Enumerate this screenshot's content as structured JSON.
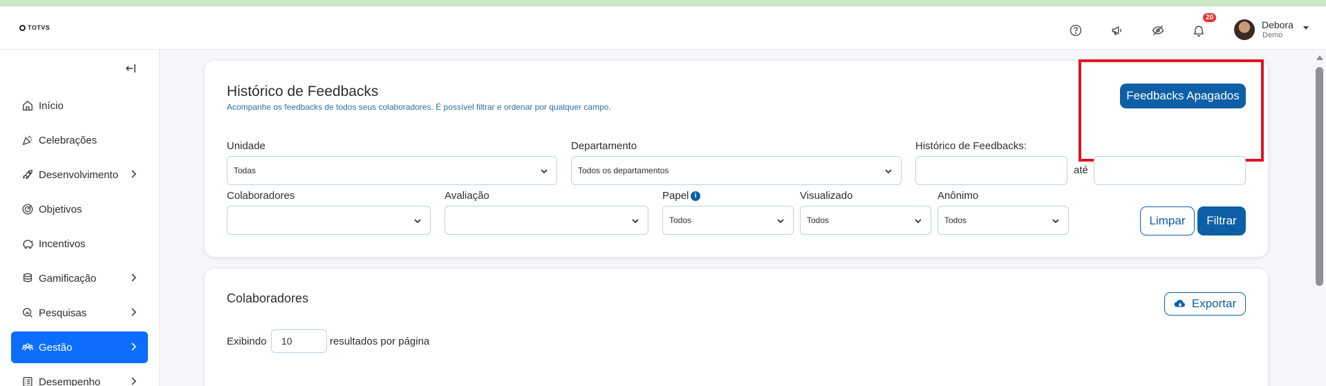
{
  "header": {
    "logo_text": "TOTVS",
    "notifications_count": "20",
    "user_name": "Debora",
    "user_role": "Demo",
    "icons": [
      "help-icon",
      "megaphone-icon",
      "eye-off-icon",
      "bell-icon"
    ]
  },
  "sidebar": {
    "items": [
      {
        "label": "Início",
        "icon": "home-icon",
        "has_children": false,
        "active": false
      },
      {
        "label": "Celebrações",
        "icon": "party-icon",
        "has_children": false,
        "active": false
      },
      {
        "label": "Desenvolvimento",
        "icon": "rocket-icon",
        "has_children": true,
        "active": false
      },
      {
        "label": "Objetivos",
        "icon": "target-icon",
        "has_children": false,
        "active": false
      },
      {
        "label": "Incentivos",
        "icon": "piggy-bank-icon",
        "has_children": false,
        "active": false
      },
      {
        "label": "Gamificação",
        "icon": "coins-icon",
        "has_children": true,
        "active": false
      },
      {
        "label": "Pesquisas",
        "icon": "survey-icon",
        "has_children": true,
        "active": false
      },
      {
        "label": "Gestão",
        "icon": "team-icon",
        "has_children": true,
        "active": true
      },
      {
        "label": "Desempenho",
        "icon": "checklist-icon",
        "has_children": true,
        "active": false
      }
    ],
    "accent_color": "#0d6efd"
  },
  "filters_card": {
    "title": "Histórico de Feedbacks",
    "subtitle": "Acompanhe os feedbacks de todos seus colaboradores. É possível filtrar e ordenar por qualquer campo.",
    "deleted_button": "Feedbacks Apagados",
    "unidade": {
      "label": "Unidade",
      "value": "Todas"
    },
    "departamento": {
      "label": "Departamento",
      "value": "Todos os departamentos"
    },
    "historico": {
      "label": "Histórico de Feedbacks:",
      "between": "até",
      "from": "",
      "to": ""
    },
    "colaboradores": {
      "label": "Colaboradores",
      "value": ""
    },
    "avaliacao": {
      "label": "Avaliação",
      "value": ""
    },
    "papel": {
      "label": "Papel",
      "value": "Todos"
    },
    "visualizado": {
      "label": "Visualizado",
      "value": "Todos"
    },
    "anonimo": {
      "label": "Anônimo",
      "value": "Todos"
    },
    "clear_button": "Limpar",
    "filter_button": "Filtrar"
  },
  "results_card": {
    "title": "Colaboradores",
    "export_button": "Exportar",
    "showing_label": "Exibindo",
    "per_page_value": "10",
    "per_page_suffix": "resultados por página"
  },
  "colors": {
    "primary": "#0d5fa6",
    "highlight": "#e0141e",
    "notification": "#e3342f"
  }
}
